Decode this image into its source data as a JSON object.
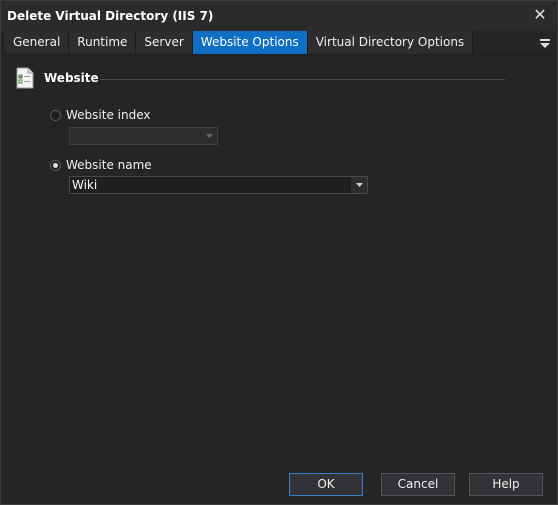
{
  "window": {
    "title": "Delete Virtual Directory (IIS 7)"
  },
  "tabs": [
    {
      "label": "General"
    },
    {
      "label": "Runtime"
    },
    {
      "label": "Server"
    },
    {
      "label": "Website Options",
      "active": true
    },
    {
      "label": "Virtual Directory Options"
    }
  ],
  "section": {
    "title": "Website"
  },
  "options": {
    "website_index": {
      "label": "Website index",
      "selected": false,
      "value": ""
    },
    "website_name": {
      "label": "Website name",
      "selected": true,
      "value": "Wiki"
    }
  },
  "buttons": {
    "ok": "OK",
    "cancel": "Cancel",
    "help": "Help"
  },
  "colors": {
    "accent": "#0e6fc4",
    "background": "#252526"
  }
}
